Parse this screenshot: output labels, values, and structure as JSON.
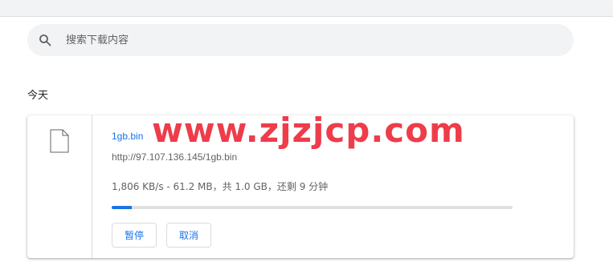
{
  "search": {
    "placeholder": "搜索下载内容",
    "icon": "search-icon"
  },
  "section": {
    "date_label": "今天"
  },
  "download": {
    "file_name": "1gb.bin",
    "url": "http://97.107.136.145/1gb.bin",
    "progress_text": "1,806 KB/s - 61.2 MB，共 1.0 GB，还剩 9 分钟",
    "progress_fraction": 0.05,
    "file_icon": "file-icon",
    "buttons": {
      "pause": "暂停",
      "cancel": "取消"
    }
  },
  "watermark": {
    "text": "www.zjzjcp.com",
    "color": "#ee3c4a"
  },
  "colors": {
    "accent": "#1a73e8",
    "secondary_text": "#5f6368",
    "search_background": "#f1f3f4"
  }
}
